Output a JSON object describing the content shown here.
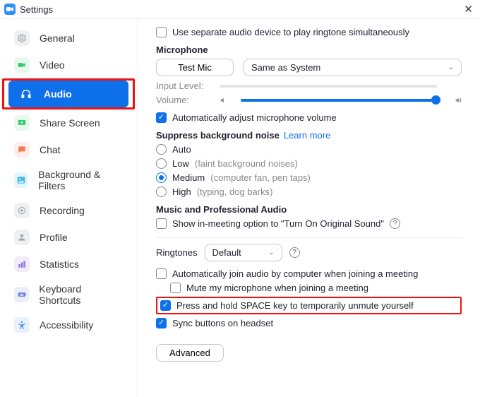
{
  "window": {
    "title": "Settings"
  },
  "sidebar": {
    "items": [
      {
        "label": "General"
      },
      {
        "label": "Video"
      },
      {
        "label": "Audio"
      },
      {
        "label": "Share Screen"
      },
      {
        "label": "Chat"
      },
      {
        "label": "Background & Filters"
      },
      {
        "label": "Recording"
      },
      {
        "label": "Profile"
      },
      {
        "label": "Statistics"
      },
      {
        "label": "Keyboard Shortcuts"
      },
      {
        "label": "Accessibility"
      }
    ]
  },
  "audio": {
    "separate_device": "Use separate audio device to play ringtone simultaneously",
    "mic_section": "Microphone",
    "test_mic": "Test Mic",
    "mic_device": "Same as System",
    "input_level": "Input Level:",
    "volume": "Volume:",
    "auto_adjust": "Automatically adjust microphone volume",
    "noise_section": "Suppress background noise",
    "learn_more": "Learn more",
    "noise_auto": "Auto",
    "noise_low": "Low",
    "noise_low_hint": "(faint background noises)",
    "noise_med": "Medium",
    "noise_med_hint": "(computer fan, pen taps)",
    "noise_high": "High",
    "noise_high_hint": "(typing, dog barks)",
    "music_section": "Music and Professional Audio",
    "original_sound": "Show in-meeting option to \"Turn On Original Sound\"",
    "ringtones_label": "Ringtones",
    "ringtone_value": "Default",
    "auto_join": "Automatically join audio by computer when joining a meeting",
    "mute_on_join": "Mute my microphone when joining a meeting",
    "space_unmute": "Press and hold SPACE key to temporarily unmute yourself",
    "sync_headset": "Sync buttons on headset",
    "advanced": "Advanced"
  }
}
